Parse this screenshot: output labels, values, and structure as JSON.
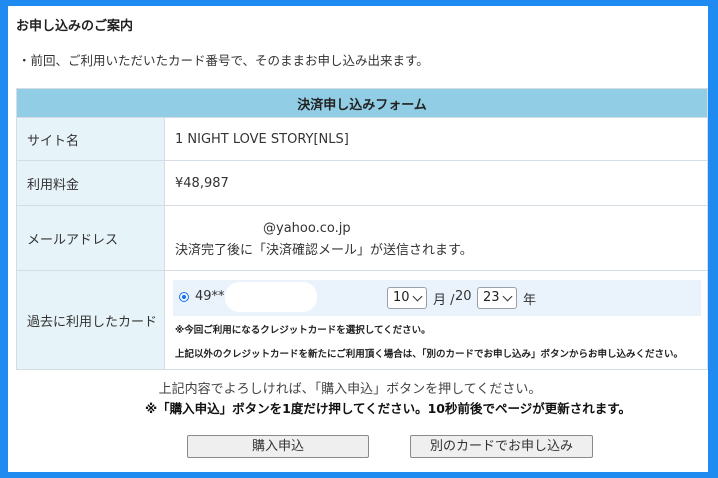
{
  "heading": "お申し込みのご案内",
  "notice": "・前回、ご利用いただいたカード番号で、そのままお申し込み出来ます。",
  "form": {
    "caption": "決済申し込みフォーム",
    "site": {
      "label": "サイト名",
      "value": "1 NIGHT LOVE STORY[NLS]"
    },
    "fee": {
      "label": "利用料金",
      "value": "¥48,987"
    },
    "email": {
      "label": "メールアドレス",
      "value": "@yahoo.co.jp",
      "note": "決済完了後に「決済確認メール」が送信されます。"
    },
    "card": {
      "label": "過去に利用したカード",
      "number": "49**",
      "month": "10",
      "month_sep": "月 /",
      "year_prefix": "20",
      "year": "23",
      "year_suffix": "年",
      "note1": "※今回ご利用になるクレジットカードを選択してください。",
      "note2": "上記以外のクレジットカードを新たにご利用頂く場合は、「別のカードでお申し込み」ボタンからお申し込みください。"
    }
  },
  "confirm_text": "上記内容でよろしければ、「購入申込」ボタンを押してください。",
  "warning_text": "※「購入申込」ボタンを1度だけ押してください。10秒前後でページが更新されます。",
  "buttons": {
    "buy": "購入申込",
    "other_card": "別のカードでお申し込み"
  },
  "colors": {
    "frame": "#1f8bf0",
    "caption_bg": "#92cde6",
    "label_bg": "#e6f3f9",
    "radio": "#1a73e8"
  }
}
